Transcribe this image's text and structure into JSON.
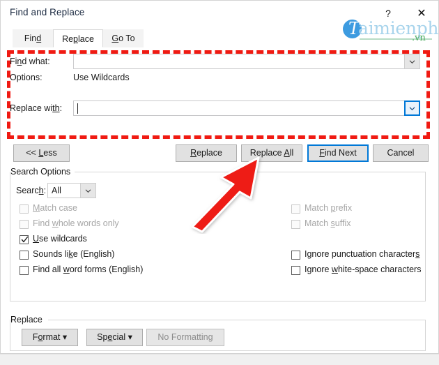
{
  "window": {
    "title": "Find and Replace",
    "help_button": "?",
    "close_button": "✕"
  },
  "watermark": {
    "monogram": "T",
    "name": "aimienphi",
    "tld": ".vn"
  },
  "tabs": [
    {
      "label_before": "Fin",
      "accel": "d",
      "label_after": "",
      "active": false,
      "name": "tab-find"
    },
    {
      "label_before": "Re",
      "accel": "p",
      "label_after": "lace",
      "active": true,
      "name": "tab-replace"
    },
    {
      "label_before": "",
      "accel": "G",
      "label_after": "o To",
      "active": false,
      "name": "tab-goto"
    }
  ],
  "fields": {
    "find_what_label_before": "Fi",
    "find_what_label_accel": "n",
    "find_what_label_after": "d what:",
    "find_what_value": "",
    "options_label": "Options:",
    "options_value": "Use Wildcards",
    "replace_with_label_before": "Replace wi",
    "replace_with_label_accel": "th",
    "replace_with_label_after": ":",
    "replace_with_value": ""
  },
  "buttons": {
    "less": {
      "before": "<< ",
      "accel": "L",
      "after": "ess"
    },
    "replace": {
      "before": "",
      "accel": "R",
      "after": "eplace"
    },
    "replace_all": {
      "before": "Replace ",
      "accel": "A",
      "after": "ll"
    },
    "find_next": {
      "before": "",
      "accel": "F",
      "after": "ind Next"
    },
    "cancel": {
      "before": "Cancel",
      "accel": "",
      "after": ""
    }
  },
  "search_options": {
    "group_title": "Search Options",
    "search_label_before": "Searc",
    "search_label_accel": "h",
    "search_label_after": ":",
    "search_value": "All",
    "left_checkboxes": [
      {
        "before": "",
        "accel": "M",
        "after": "atch case",
        "checked": false,
        "disabled": true,
        "name": "checkbox-match-case"
      },
      {
        "before": "Find ",
        "accel": "w",
        "after": "hole words only",
        "checked": false,
        "disabled": true,
        "name": "checkbox-find-whole-words-only"
      },
      {
        "before": "",
        "accel": "U",
        "after": "se wildcards",
        "checked": true,
        "disabled": false,
        "name": "checkbox-use-wildcards"
      },
      {
        "before": "Sounds li",
        "accel": "k",
        "after": "e (English)",
        "checked": false,
        "disabled": false,
        "name": "checkbox-sounds-like"
      },
      {
        "before": "Find all ",
        "accel": "w",
        "after": "ord forms (English)",
        "checked": false,
        "disabled": false,
        "name": "checkbox-find-all-word-forms"
      }
    ],
    "right_checkboxes": [
      {
        "before": "Match ",
        "accel": "p",
        "after": "refix",
        "checked": false,
        "disabled": true,
        "name": "checkbox-match-prefix"
      },
      {
        "before": "Match ",
        "accel": "s",
        "after": "uffix",
        "checked": false,
        "disabled": true,
        "name": "checkbox-match-suffix"
      },
      {
        "before": "Ignore punctuation character",
        "accel": "s",
        "after": "",
        "checked": false,
        "disabled": false,
        "name": "checkbox-ignore-punctuation"
      },
      {
        "before": "Ignore ",
        "accel": "w",
        "after": "hite-space characters",
        "checked": false,
        "disabled": false,
        "name": "checkbox-ignore-whitespace"
      }
    ]
  },
  "replace_group": {
    "group_title": "Replace",
    "format": {
      "before": "F",
      "accel": "o",
      "after": "rmat",
      "caret": "▾"
    },
    "special": {
      "before": "Sp",
      "accel": "e",
      "after": "cial",
      "caret": "▾"
    },
    "no_formatting": {
      "before": "No Formatting",
      "accel": "",
      "after": ""
    }
  },
  "annotations": {
    "highlight_color": "#f01a12",
    "arrow_color": "#ee1c16",
    "arrow_target": "replace-all-button"
  },
  "colors": {
    "accent": "#0078d7",
    "dialog_bg": "#ffffff",
    "button_face": "#e1e1e1",
    "watermark_blue": "#3d9be0",
    "watermark_light": "#a8d4ec",
    "watermark_green": "#4bab5e"
  }
}
